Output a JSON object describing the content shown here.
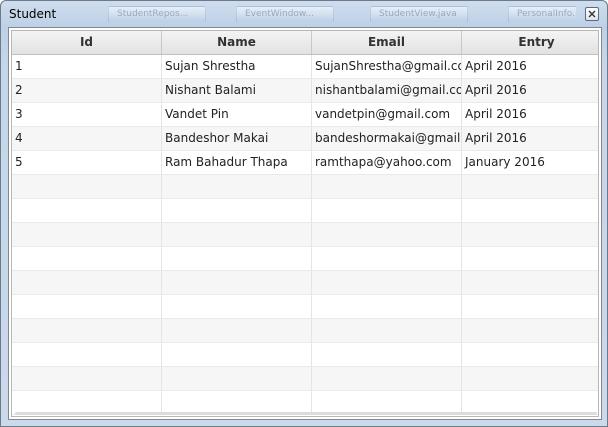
{
  "window": {
    "title": "Student",
    "background_tabs": [
      "StudentRepos...",
      "EventWindow...",
      "StudentView.java",
      "PersonalInfo..."
    ]
  },
  "table": {
    "columns": [
      "Id",
      "Name",
      "Email",
      "Entry"
    ],
    "rows": [
      [
        "1",
        "Sujan Shrestha",
        "SujanShrestha@gmail.com",
        "April 2016"
      ],
      [
        "2",
        "Nishant Balami",
        "nishantbalami@gmail.com",
        "April 2016"
      ],
      [
        "3",
        "Vandet Pin",
        "vandetpin@gmail.com",
        "April 2016"
      ],
      [
        "4",
        "Bandeshor Makai",
        "bandeshormakai@gmail....",
        "April 2016"
      ],
      [
        "5",
        "Ram Bahadur Thapa",
        "ramthapa@yahoo.com",
        "January 2016"
      ]
    ]
  },
  "colors": {
    "title_bar": "#bdd0e6",
    "header_bg": "#e6e6e6",
    "row_alt": "#f6f6f6",
    "border": "#b7b7b7"
  },
  "icons": {
    "close": "close-icon"
  }
}
